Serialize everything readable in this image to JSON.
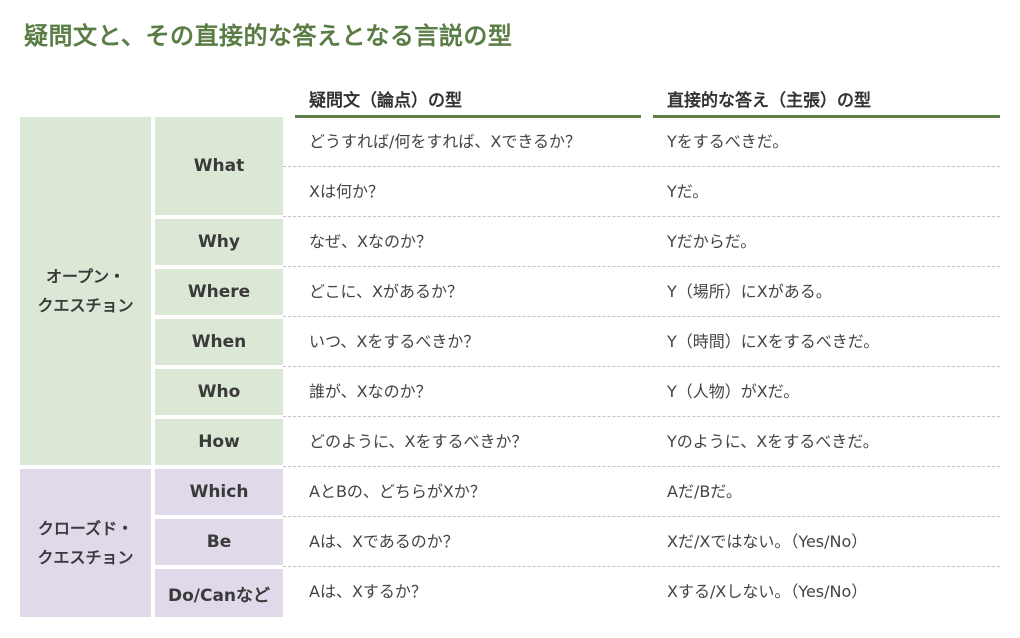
{
  "title": "疑問文と、その直接的な答えとなる言説の型",
  "colors": {
    "accent": "#5a7d45",
    "header_rule": "#5e7f49",
    "open_bg": "#dbe8d5",
    "closed_bg": "#e0d9ea"
  },
  "headers": {
    "question": "疑問文（論点）の型",
    "answer": "直接的な答え（主張）の型"
  },
  "groups": [
    {
      "label_line1": "オープン・",
      "label_line2": "クエスチョン",
      "types": [
        {
          "type": "What",
          "rows": [
            {
              "q": "どうすれば/何をすれば、Xできるか？",
              "a": "Yをするべきだ。"
            },
            {
              "q": "Xは何か？",
              "a": "Yだ。"
            }
          ]
        },
        {
          "type": "Why",
          "rows": [
            {
              "q": "なぜ、Xなのか？",
              "a": "Yだからだ。"
            }
          ]
        },
        {
          "type": "Where",
          "rows": [
            {
              "q": "どこに、Xがあるか？",
              "a": "Y（場所）にXがある。"
            }
          ]
        },
        {
          "type": "When",
          "rows": [
            {
              "q": "いつ、Xをするべきか？",
              "a": "Y（時間）にXをするべきだ。"
            }
          ]
        },
        {
          "type": "Who",
          "rows": [
            {
              "q": "誰が、Xなのか？",
              "a": "Y（人物）がXだ。"
            }
          ]
        },
        {
          "type": "How",
          "rows": [
            {
              "q": "どのように、Xをするべきか？",
              "a": "Yのように、Xをするべきだ。"
            }
          ]
        }
      ]
    },
    {
      "label_line1": "クローズド・",
      "label_line2": "クエスチョン",
      "types": [
        {
          "type": "Which",
          "rows": [
            {
              "q": "AとBの、どちらがXか？",
              "a": "Aだ/Bだ。"
            }
          ]
        },
        {
          "type": "Be",
          "rows": [
            {
              "q": "Aは、Xであるのか？",
              "a": "Xだ/Xではない。（Yes/No）"
            }
          ]
        },
        {
          "type": "Do/Canなど",
          "rows": [
            {
              "q": "Aは、Xするか？",
              "a": "Xする/Xしない。（Yes/No）"
            }
          ]
        }
      ]
    }
  ]
}
